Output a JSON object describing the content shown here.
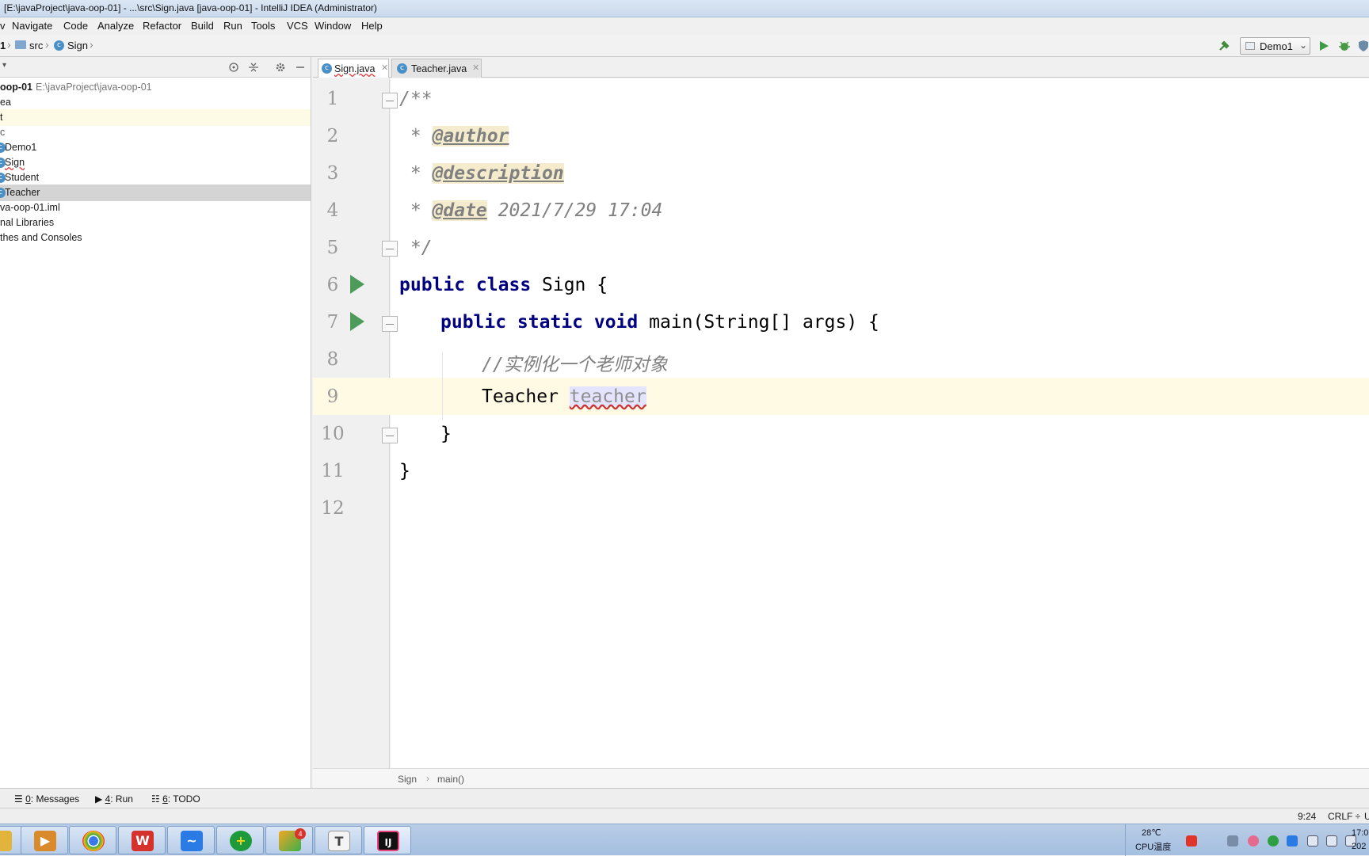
{
  "window": {
    "title": "[E:\\javaProject\\java-oop-01] - ...\\src\\Sign.java [java-oop-01] - IntelliJ IDEA (Administrator)"
  },
  "menu": [
    "v",
    "Navigate",
    "Code",
    "Analyze",
    "Refactor",
    "Build",
    "Run",
    "Tools",
    "VCS",
    "Window",
    "Help"
  ],
  "navbar": {
    "crumbs": [
      "1",
      "src",
      "Sign"
    ],
    "run_config": "Demo1"
  },
  "project": {
    "root_name": "oop-01",
    "root_path": "E:\\javaProject\\java-oop-01",
    "items": [
      "ea",
      "t",
      "c",
      "Demo1",
      "Sign",
      "Student",
      "Teacher",
      "va-oop-01.iml",
      "nal Libraries",
      "thes and Consoles"
    ]
  },
  "tabs": [
    "Sign.java",
    "Teacher.java"
  ],
  "editor": {
    "line_numbers": [
      "1",
      "2",
      "3",
      "4",
      "5",
      "6",
      "7",
      "8",
      "9",
      "10",
      "11",
      "12"
    ],
    "lines": {
      "l1": "/**",
      "l2_star": " * ",
      "l2_tag": "@author",
      "l3_star": " * ",
      "l3_tag": "@description",
      "l4_star": " * ",
      "l4_tag": "@date",
      "l4_rest": " 2021/7/29 17:04",
      "l5": " */",
      "l6_kw": "public class",
      "l6_rest": " Sign {",
      "l7_kw": "public static void",
      "l7_rest": " main(String[] args) {",
      "l8": "//实例化一个老师对象",
      "l9_type": "Teacher ",
      "l9_var": "teacher",
      "l10": "}",
      "l11": "}"
    }
  },
  "code_breadcrumb": [
    "Sign",
    "main()"
  ],
  "tool_windows": [
    {
      "num": "0",
      "label": ": Messages"
    },
    {
      "num": "4",
      "label": ": Run"
    },
    {
      "num": "6",
      "label": ": TODO"
    }
  ],
  "status": {
    "position": "9:24",
    "line_sep": "CRLF ÷",
    "encoding": "U"
  },
  "taskbar": {
    "temperature": "28℃",
    "cpu_label": "CPU温度",
    "clock": "17:0",
    "date": "202",
    "badge_count": "4",
    "apps": [
      "file-explorer",
      "media-player",
      "chrome",
      "wps",
      "feishu",
      "game-plus",
      "app-store",
      "typora",
      "intellij"
    ]
  },
  "colors": {
    "keyword": "#000080",
    "comment": "#808080",
    "caret_line": "#fffae3",
    "run_green": "#4c9b5a",
    "taskbar": "#b9cde6"
  }
}
